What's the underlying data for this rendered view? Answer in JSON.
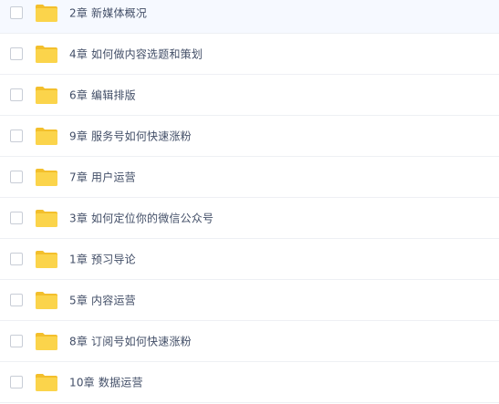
{
  "folders": [
    {
      "name": "2章 新媒体概况",
      "highlighted": true
    },
    {
      "name": "4章 如何做内容选题和策划",
      "highlighted": false
    },
    {
      "name": "6章 编辑排版",
      "highlighted": false
    },
    {
      "name": "9章 服务号如何快速涨粉",
      "highlighted": false
    },
    {
      "name": "7章 用户运营",
      "highlighted": false
    },
    {
      "name": "3章 如何定位你的微信公众号",
      "highlighted": false
    },
    {
      "name": "1章 预习导论",
      "highlighted": false
    },
    {
      "name": "5章 内容运营",
      "highlighted": false
    },
    {
      "name": "8章 订阅号如何快速涨粉",
      "highlighted": false
    },
    {
      "name": "10章 数据运营",
      "highlighted": false
    }
  ],
  "colors": {
    "folder_body": "#fbd44b",
    "folder_tab": "#f3bf2c",
    "text": "#424e67",
    "highlight_bg": "#f6f9ff"
  },
  "icons": {
    "row_icon": "folder-icon",
    "row_select": "checkbox"
  }
}
